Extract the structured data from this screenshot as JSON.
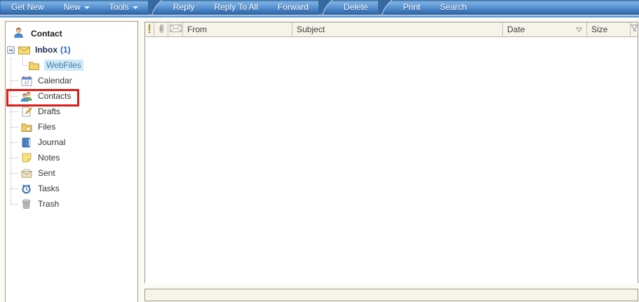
{
  "toolbar": {
    "groups": [
      {
        "name": "mailbox-actions",
        "items": [
          {
            "label": "Get New",
            "dropdown": false
          },
          {
            "label": "New",
            "dropdown": true
          },
          {
            "label": "Tools",
            "dropdown": true
          }
        ]
      },
      {
        "name": "message-actions",
        "items": [
          {
            "label": "Reply"
          },
          {
            "label": "Reply To All"
          },
          {
            "label": "Forward"
          }
        ]
      },
      {
        "name": "delete-actions",
        "items": [
          {
            "label": "Delete"
          }
        ]
      },
      {
        "name": "utility-actions",
        "items": [
          {
            "label": "Print"
          },
          {
            "label": "Search"
          }
        ]
      }
    ]
  },
  "sidebar": {
    "header": {
      "label": "Contact",
      "icon": "person-icon"
    },
    "tree": [
      {
        "label": "Inbox",
        "count": "(1)",
        "icon": "inbox-envelope-icon",
        "expanded": true
      },
      {
        "label": "WebFiles",
        "icon": "folder-icon",
        "selected": true,
        "level": 2
      },
      {
        "label": "Calendar",
        "icon": "calendar-icon",
        "calendar_day": "17"
      },
      {
        "label": "Contacts",
        "icon": "contacts-icon",
        "annotated": true
      },
      {
        "label": "Drafts",
        "icon": "drafts-icon"
      },
      {
        "label": "Files",
        "icon": "files-icon"
      },
      {
        "label": "Journal",
        "icon": "journal-icon"
      },
      {
        "label": "Notes",
        "icon": "notes-icon"
      },
      {
        "label": "Sent",
        "icon": "sent-icon"
      },
      {
        "label": "Tasks",
        "icon": "tasks-icon"
      },
      {
        "label": "Trash",
        "icon": "trash-icon"
      }
    ]
  },
  "message_list": {
    "columns": [
      {
        "id": "importance",
        "icon": "importance-icon",
        "label": ""
      },
      {
        "id": "attachment",
        "icon": "attachment-icon",
        "label": ""
      },
      {
        "id": "read",
        "icon": "envelope-icon",
        "label": ""
      },
      {
        "id": "from",
        "label": "From"
      },
      {
        "id": "subject",
        "label": "Subject"
      },
      {
        "id": "date",
        "label": "Date",
        "sort": "desc"
      },
      {
        "id": "size",
        "label": "Size"
      },
      {
        "id": "filter",
        "icon": "filter-icon",
        "label": ""
      }
    ],
    "rows": []
  },
  "annotation": {
    "shape": "rectangle",
    "color": "#dc1b15",
    "target": "sidebar-item-contacts"
  },
  "colors": {
    "toolbar_blue_top": "#7cb0df",
    "toolbar_blue_bottom": "#32689f",
    "toolbar_bottom_line": "#1d4e90",
    "selection_bg": "#cfe9f8",
    "panel_border": "#9b998a",
    "header_bg": "#f6f3ea",
    "webfiles_link_blue": "#4578a5",
    "inbox_count_blue": "#2b5cc8",
    "annotation_red": "#dc1b15"
  }
}
